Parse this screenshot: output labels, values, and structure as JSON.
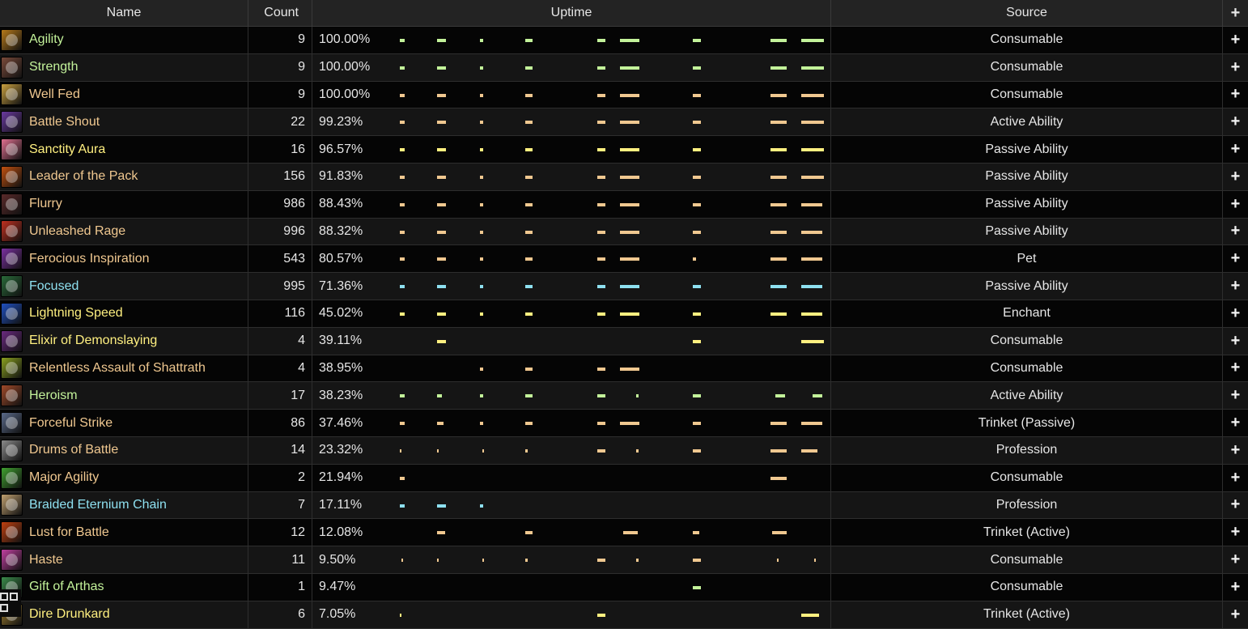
{
  "headers": {
    "name": "Name",
    "count": "Count",
    "uptime": "Uptime",
    "source": "Source",
    "expand": "+"
  },
  "rows": [
    {
      "name": "Agility",
      "count": "9",
      "uptime": "100.00%",
      "source": "Consumable",
      "color": "#c3f29a",
      "icon": "#b77a1a",
      "segs": [
        [
          108,
          6
        ],
        [
          154,
          11
        ],
        [
          207,
          4
        ],
        [
          263,
          9
        ],
        [
          352,
          10
        ],
        [
          380,
          24
        ],
        [
          470,
          10
        ],
        [
          566,
          20
        ],
        [
          604,
          28
        ]
      ]
    },
    {
      "name": "Strength",
      "count": "9",
      "uptime": "100.00%",
      "source": "Consumable",
      "color": "#c3f29a",
      "icon": "#7a4a3a",
      "segs": [
        [
          108,
          6
        ],
        [
          154,
          11
        ],
        [
          207,
          4
        ],
        [
          263,
          9
        ],
        [
          352,
          10
        ],
        [
          380,
          24
        ],
        [
          470,
          10
        ],
        [
          566,
          20
        ],
        [
          604,
          28
        ]
      ]
    },
    {
      "name": "Well Fed",
      "count": "9",
      "uptime": "100.00%",
      "source": "Consumable",
      "color": "#f0c890",
      "icon": "#c9a040",
      "segs": [
        [
          108,
          6
        ],
        [
          154,
          11
        ],
        [
          207,
          4
        ],
        [
          263,
          9
        ],
        [
          352,
          10
        ],
        [
          380,
          24
        ],
        [
          470,
          10
        ],
        [
          566,
          20
        ],
        [
          604,
          28
        ]
      ]
    },
    {
      "name": "Battle Shout",
      "count": "22",
      "uptime": "99.23%",
      "source": "Active Ability",
      "color": "#f0c890",
      "icon": "#6a3aa0",
      "segs": [
        [
          108,
          6
        ],
        [
          154,
          11
        ],
        [
          207,
          4
        ],
        [
          263,
          9
        ],
        [
          352,
          10
        ],
        [
          380,
          24
        ],
        [
          470,
          10
        ],
        [
          566,
          20
        ],
        [
          604,
          28
        ]
      ]
    },
    {
      "name": "Sanctity Aura",
      "count": "16",
      "uptime": "96.57%",
      "source": "Passive Ability",
      "color": "#fff080",
      "icon": "#e07090",
      "segs": [
        [
          108,
          6
        ],
        [
          154,
          11
        ],
        [
          207,
          4
        ],
        [
          263,
          9
        ],
        [
          352,
          10
        ],
        [
          380,
          24
        ],
        [
          470,
          10
        ],
        [
          566,
          20
        ],
        [
          604,
          28
        ]
      ]
    },
    {
      "name": "Leader of the Pack",
      "count": "156",
      "uptime": "91.83%",
      "source": "Passive Ability",
      "color": "#f0c890",
      "icon": "#c05010",
      "segs": [
        [
          108,
          6
        ],
        [
          154,
          11
        ],
        [
          207,
          4
        ],
        [
          263,
          9
        ],
        [
          352,
          10
        ],
        [
          380,
          24
        ],
        [
          470,
          10
        ],
        [
          566,
          20
        ],
        [
          604,
          28
        ]
      ]
    },
    {
      "name": "Flurry",
      "count": "986",
      "uptime": "88.43%",
      "source": "Passive Ability",
      "color": "#f0c890",
      "icon": "#5a2a2a",
      "segs": [
        [
          108,
          6
        ],
        [
          154,
          11
        ],
        [
          207,
          4
        ],
        [
          263,
          9
        ],
        [
          352,
          10
        ],
        [
          380,
          24
        ],
        [
          470,
          10
        ],
        [
          566,
          20
        ],
        [
          604,
          26
        ]
      ]
    },
    {
      "name": "Unleashed Rage",
      "count": "996",
      "uptime": "88.32%",
      "source": "Passive Ability",
      "color": "#f0c890",
      "icon": "#c03020",
      "segs": [
        [
          108,
          6
        ],
        [
          154,
          11
        ],
        [
          207,
          4
        ],
        [
          263,
          9
        ],
        [
          352,
          10
        ],
        [
          380,
          24
        ],
        [
          470,
          10
        ],
        [
          566,
          20
        ],
        [
          604,
          26
        ]
      ]
    },
    {
      "name": "Ferocious Inspiration",
      "count": "543",
      "uptime": "80.57%",
      "source": "Pet",
      "color": "#f0c890",
      "icon": "#7a30a0",
      "segs": [
        [
          108,
          6
        ],
        [
          154,
          11
        ],
        [
          207,
          4
        ],
        [
          263,
          9
        ],
        [
          352,
          10
        ],
        [
          380,
          24
        ],
        [
          470,
          4
        ],
        [
          566,
          20
        ],
        [
          604,
          26
        ]
      ]
    },
    {
      "name": "Focused",
      "count": "995",
      "uptime": "71.36%",
      "source": "Passive Ability",
      "color": "#8ee0f0",
      "icon": "#2a6a3a",
      "segs": [
        [
          108,
          6
        ],
        [
          154,
          11
        ],
        [
          207,
          4
        ],
        [
          263,
          9
        ],
        [
          352,
          10
        ],
        [
          380,
          24
        ],
        [
          470,
          10
        ],
        [
          566,
          20
        ],
        [
          604,
          26
        ]
      ]
    },
    {
      "name": "Lightning Speed",
      "count": "116",
      "uptime": "45.02%",
      "source": "Enchant",
      "color": "#fff080",
      "icon": "#2050c0",
      "segs": [
        [
          108,
          6
        ],
        [
          154,
          11
        ],
        [
          207,
          4
        ],
        [
          263,
          9
        ],
        [
          352,
          10
        ],
        [
          380,
          24
        ],
        [
          470,
          10
        ],
        [
          566,
          20
        ],
        [
          604,
          26
        ]
      ]
    },
    {
      "name": "Elixir of Demonslaying",
      "count": "4",
      "uptime": "39.11%",
      "source": "Consumable",
      "color": "#fff080",
      "icon": "#6a2a80",
      "segs": [
        [
          154,
          11
        ],
        [
          470,
          10
        ],
        [
          604,
          28
        ]
      ]
    },
    {
      "name": "Relentless Assault of Shattrath",
      "count": "4",
      "uptime": "38.95%",
      "source": "Consumable",
      "color": "#f0c890",
      "icon": "#8aa020",
      "segs": [
        [
          207,
          4
        ],
        [
          263,
          9
        ],
        [
          352,
          10
        ],
        [
          380,
          24
        ]
      ]
    },
    {
      "name": "Heroism",
      "count": "17",
      "uptime": "38.23%",
      "source": "Active Ability",
      "color": "#c3f29a",
      "icon": "#a04a2a",
      "segs": [
        [
          108,
          6
        ],
        [
          154,
          6
        ],
        [
          207,
          4
        ],
        [
          263,
          9
        ],
        [
          352,
          10
        ],
        [
          400,
          3
        ],
        [
          470,
          10
        ],
        [
          572,
          12
        ],
        [
          618,
          12
        ]
      ]
    },
    {
      "name": "Forceful Strike",
      "count": "86",
      "uptime": "37.46%",
      "source": "Trinket (Passive)",
      "color": "#f0c890",
      "icon": "#5a6a8a",
      "segs": [
        [
          108,
          6
        ],
        [
          154,
          8
        ],
        [
          207,
          4
        ],
        [
          263,
          9
        ],
        [
          352,
          10
        ],
        [
          380,
          24
        ],
        [
          470,
          10
        ],
        [
          566,
          20
        ],
        [
          604,
          26
        ]
      ]
    },
    {
      "name": "Drums of Battle",
      "count": "14",
      "uptime": "23.32%",
      "source": "Profession",
      "color": "#f0c890",
      "icon": "#8a8a8a",
      "segs": [
        [
          108,
          2
        ],
        [
          154,
          2
        ],
        [
          210,
          2
        ],
        [
          263,
          3
        ],
        [
          352,
          10
        ],
        [
          400,
          3
        ],
        [
          470,
          10
        ],
        [
          566,
          20
        ],
        [
          604,
          20
        ]
      ]
    },
    {
      "name": "Major Agility",
      "count": "2",
      "uptime": "21.94%",
      "source": "Consumable",
      "color": "#f0c890",
      "icon": "#40a030",
      "segs": [
        [
          108,
          6
        ],
        [
          566,
          20
        ]
      ]
    },
    {
      "name": "Braided Eternium Chain",
      "count": "7",
      "uptime": "17.11%",
      "source": "Profession",
      "color": "#8ee0f0",
      "icon": "#c0a070",
      "segs": [
        [
          108,
          6
        ],
        [
          154,
          11
        ],
        [
          207,
          4
        ]
      ]
    },
    {
      "name": "Lust for Battle",
      "count": "12",
      "uptime": "12.08%",
      "source": "Trinket (Active)",
      "color": "#f0c890",
      "icon": "#c04010",
      "segs": [
        [
          154,
          10
        ],
        [
          263,
          9
        ],
        [
          384,
          18
        ],
        [
          470,
          8
        ],
        [
          568,
          18
        ]
      ]
    },
    {
      "name": "Haste",
      "count": "11",
      "uptime": "9.50%",
      "source": "Consumable",
      "color": "#f0c890",
      "icon": "#c040a0",
      "segs": [
        [
          110,
          2
        ],
        [
          154,
          2
        ],
        [
          210,
          2
        ],
        [
          263,
          3
        ],
        [
          352,
          10
        ],
        [
          400,
          3
        ],
        [
          470,
          10
        ],
        [
          574,
          2
        ],
        [
          620,
          2
        ]
      ]
    },
    {
      "name": "Gift of Arthas",
      "count": "1",
      "uptime": "9.47%",
      "source": "Consumable",
      "color": "#c3f29a",
      "icon": "#3a8a4a",
      "segs": [
        [
          470,
          10
        ]
      ]
    },
    {
      "name": "Dire Drunkard",
      "count": "6",
      "uptime": "7.05%",
      "source": "Trinket (Active)",
      "color": "#fff080",
      "icon": "#a08030",
      "segs": [
        [
          108,
          2
        ],
        [
          352,
          10
        ],
        [
          604,
          22
        ]
      ]
    }
  ]
}
